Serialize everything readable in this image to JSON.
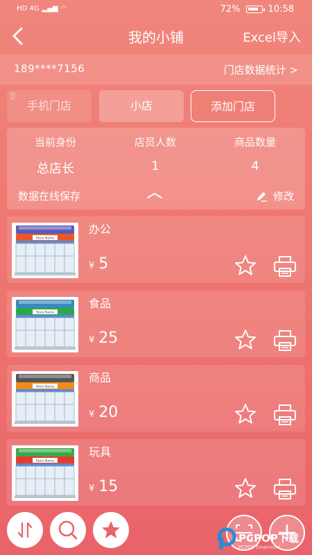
{
  "statusbar": {
    "network": "HD 4G",
    "battery": "72%",
    "time": "10:58"
  },
  "topbar": {
    "title": "我的小铺",
    "excel_import": "Excel导入"
  },
  "info": {
    "phone": "189****7156",
    "stats_link": "门店数据统计 >"
  },
  "tabs": {
    "phone_store": "手机门店",
    "small_store": "小店",
    "add_store": "添加门店"
  },
  "summary": {
    "headers": [
      "当前身份",
      "店员人数",
      "商品数量"
    ],
    "values": [
      "总店长",
      "1",
      "4"
    ],
    "online_save": "数据在线保存",
    "edit": "修改"
  },
  "items": [
    {
      "name": "办公",
      "currency": "¥",
      "price": "5",
      "stripe_color": "#e8582a",
      "roof_color": "#5a5ab8"
    },
    {
      "name": "食品",
      "currency": "¥",
      "price": "25",
      "stripe_color": "#2ba84a",
      "roof_color": "#3a8ab8"
    },
    {
      "name": "商品",
      "currency": "¥",
      "price": "20",
      "stripe_color": "#f08a1a",
      "roof_color": "#555555"
    },
    {
      "name": "玩具",
      "currency": "¥",
      "price": "15",
      "stripe_color": "#e83a2a",
      "roof_color": "#3aa84a"
    }
  ],
  "thumb_sign": "Store Name",
  "watermark": {
    "text": "PCPOP下载",
    "sub": "PCPOP Download"
  }
}
